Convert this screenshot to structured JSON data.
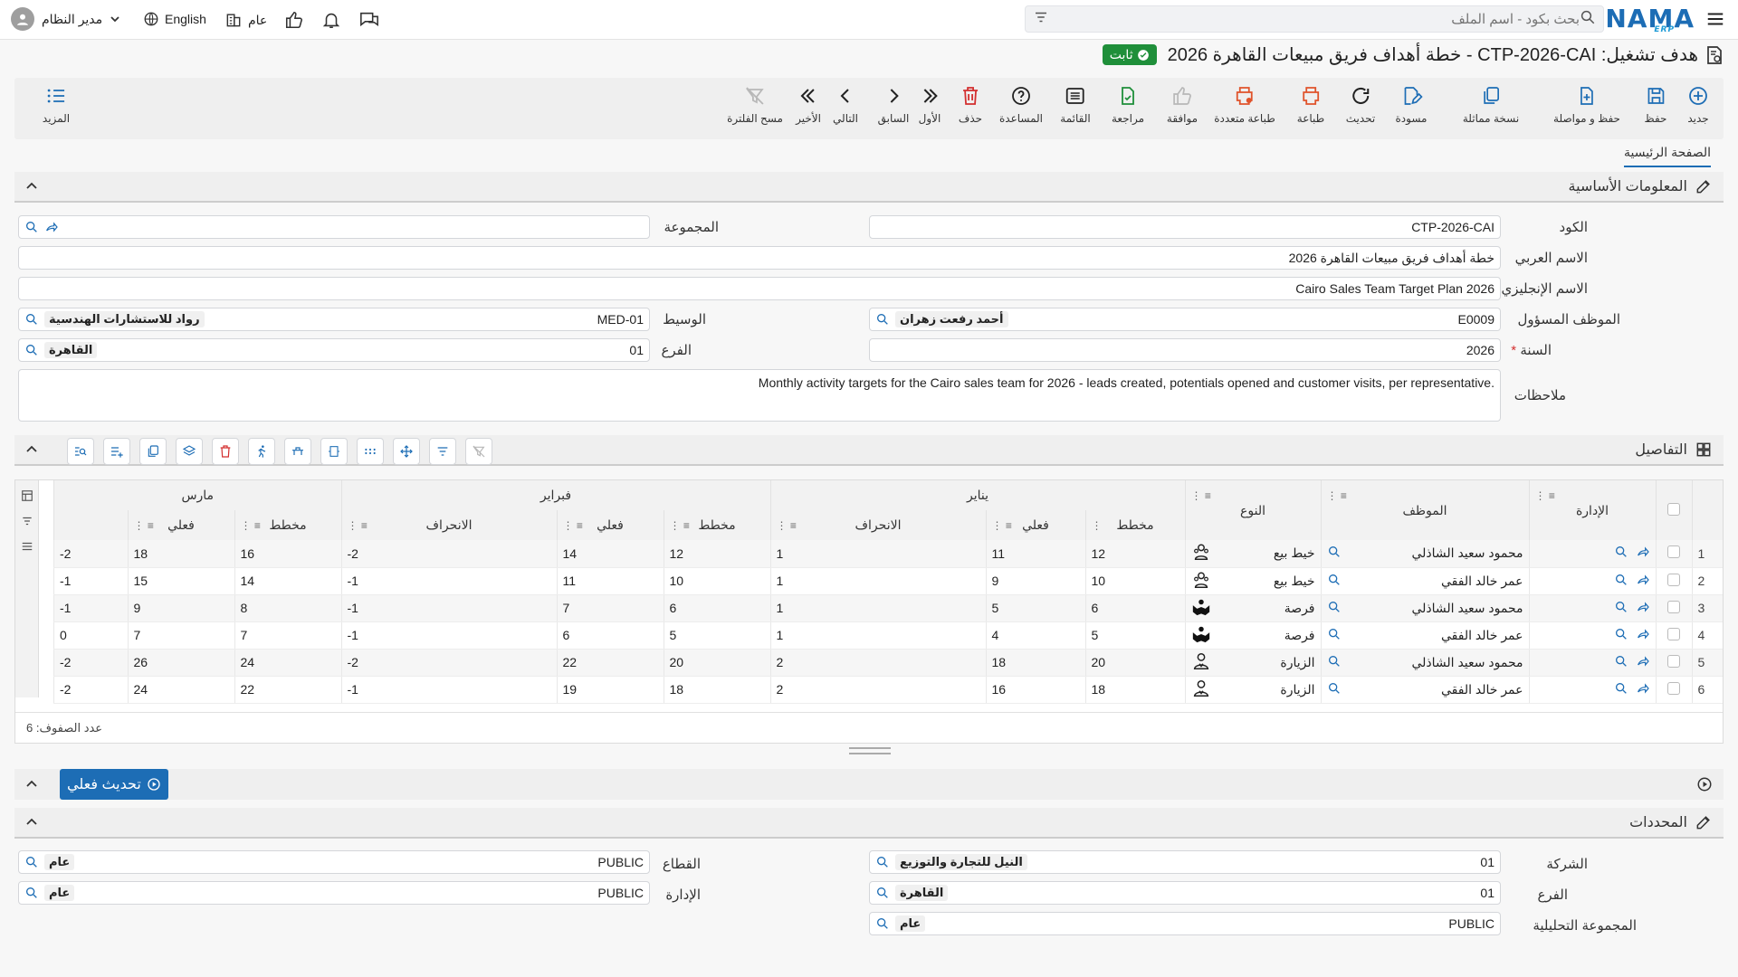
{
  "topbar": {
    "search_placeholder": "بحث بكود - اسم الملف",
    "logo": "NAMA",
    "logo_sub": "ERP",
    "user_label": "مدير النظام",
    "language": "English",
    "scope": "عام"
  },
  "title": {
    "text": "هدف تشغيل: CTP-2026-CAI - خطة أهداف فريق مبيعات القاهرة 2026",
    "status": "ثابت"
  },
  "toolbar": {
    "more": "المزيد",
    "buttons": [
      {
        "id": "new",
        "label": "جديد",
        "color": "#1d6db5"
      },
      {
        "id": "save",
        "label": "حفظ",
        "color": "#1d6db5"
      },
      {
        "id": "save-continue",
        "label": "حفظ و مواصلة",
        "color": "#1d6db5"
      },
      {
        "id": "similar-copy",
        "label": "نسخة مماثلة",
        "color": "#1d6db5"
      },
      {
        "id": "draft",
        "label": "مسودة",
        "color": "#1d6db5"
      },
      {
        "id": "refresh",
        "label": "تحديث",
        "color": "#222"
      },
      {
        "id": "print",
        "label": "طباعة",
        "color": "#e0532b"
      },
      {
        "id": "multi-print",
        "label": "طباعة متعددة",
        "color": "#e0532b"
      },
      {
        "id": "approve",
        "label": "موافقة",
        "color": "#b8b8b8"
      },
      {
        "id": "review",
        "label": "مراجعة",
        "color": "#1f8f3a"
      },
      {
        "id": "list",
        "label": "القائمة",
        "color": "#222"
      },
      {
        "id": "help",
        "label": "المساعدة",
        "color": "#222"
      },
      {
        "id": "delete",
        "label": "حذف",
        "color": "#d32f2f"
      },
      {
        "id": "first",
        "label": "الأول",
        "color": "#222"
      },
      {
        "id": "prev",
        "label": "السابق",
        "color": "#222"
      },
      {
        "id": "next",
        "label": "التالي",
        "color": "#222"
      },
      {
        "id": "last",
        "label": "الأخير",
        "color": "#222"
      },
      {
        "id": "clear-filter",
        "label": "مسح الفلترة",
        "color": "#b8b8b8"
      }
    ]
  },
  "tabs": {
    "main": "الصفحة الرئيسية"
  },
  "basic": {
    "header": "المعلومات الأساسية",
    "code_label": "الكود",
    "code": "CTP-2026-CAI",
    "group_label": "المجموعة",
    "group": "",
    "arabic_name_label": "الاسم العربي",
    "arabic_name": "خطة أهداف فريق مبيعات القاهرة 2026",
    "english_name_label": "الاسم الإنجليزي",
    "english_name": "Cairo Sales Team Target Plan 2026",
    "employee_label": "الموظف المسؤول",
    "employee_code": "E0009",
    "employee_name": "أحمد رفعت زهران",
    "broker_label": "الوسيط",
    "broker_code": "MED-01",
    "broker_name": "رواد للاستشارات الهندسية",
    "year_label": "السنة",
    "year_required": "*",
    "year": "2026",
    "branch_label": "الفرع",
    "branch_code": "01",
    "branch_name": "القاهرة",
    "notes_label": "ملاحظات",
    "notes": "Monthly activity targets for the Cairo sales team for 2026 - leads created, potentials opened and customer visits, per representative."
  },
  "details": {
    "header": "التفاصيل",
    "columns": {
      "admin": "الإدارة",
      "employee": "الموظف",
      "type": "النوع",
      "jan": "يناير",
      "feb": "فبراير",
      "mar": "مارس",
      "plan": "مخطط",
      "actual": "فعلي",
      "deviation": "الانحراف"
    },
    "rows": [
      {
        "n": "1",
        "emp": "محمود سعيد الشاذلي",
        "type": "خيط بيع",
        "icon": "lead-icon",
        "jp": "12",
        "ja": "11",
        "jd": "1",
        "fp": "12",
        "fa": "14",
        "fd": "-2",
        "mp": "16",
        "ma": "18",
        "md": "-2"
      },
      {
        "n": "2",
        "emp": "عمر خالد الفقي",
        "type": "خيط بيع",
        "icon": "lead-icon",
        "jp": "10",
        "ja": "9",
        "jd": "1",
        "fp": "10",
        "fa": "11",
        "fd": "-1",
        "mp": "14",
        "ma": "15",
        "md": "-1"
      },
      {
        "n": "3",
        "emp": "محمود سعيد الشاذلي",
        "type": "فرصة",
        "icon": "opportunity-icon",
        "jp": "6",
        "ja": "5",
        "jd": "1",
        "fp": "6",
        "fa": "7",
        "fd": "-1",
        "mp": "8",
        "ma": "9",
        "md": "-1"
      },
      {
        "n": "4",
        "emp": "عمر خالد الفقي",
        "type": "فرصة",
        "icon": "opportunity-icon",
        "jp": "5",
        "ja": "4",
        "jd": "1",
        "fp": "5",
        "fa": "6",
        "fd": "-1",
        "mp": "7",
        "ma": "7",
        "md": "0"
      },
      {
        "n": "5",
        "emp": "محمود سعيد الشاذلي",
        "type": "الزيارة",
        "icon": "visit-icon",
        "jp": "20",
        "ja": "18",
        "jd": "2",
        "fp": "20",
        "fa": "22",
        "fd": "-2",
        "mp": "24",
        "ma": "26",
        "md": "-2"
      },
      {
        "n": "6",
        "emp": "عمر خالد الفقي",
        "type": "الزيارة",
        "icon": "visit-icon",
        "jp": "18",
        "ja": "16",
        "jd": "2",
        "fp": "18",
        "fa": "19",
        "fd": "-1",
        "mp": "22",
        "ma": "24",
        "md": "-2"
      }
    ],
    "row_count_label": "عدد الصفوف:",
    "row_count": "6"
  },
  "actions": {
    "update_actual": "تحديث فعلي"
  },
  "determinants": {
    "header": "المحددات",
    "company_label": "الشركة",
    "company_code": "01",
    "company_name": "النيل للتجارة والتوزيع",
    "sector_label": "القطاع",
    "sector_code": "PUBLIC",
    "sector_name": "عام",
    "branch_label": "الفرع",
    "branch_code": "01",
    "branch_name": "القاهرة",
    "dept_label": "الإدارة",
    "dept_code": "PUBLIC",
    "dept_name": "عام",
    "analytic_label": "المجموعة التحليلية",
    "analytic_code": "PUBLIC",
    "analytic_name": "عام"
  }
}
